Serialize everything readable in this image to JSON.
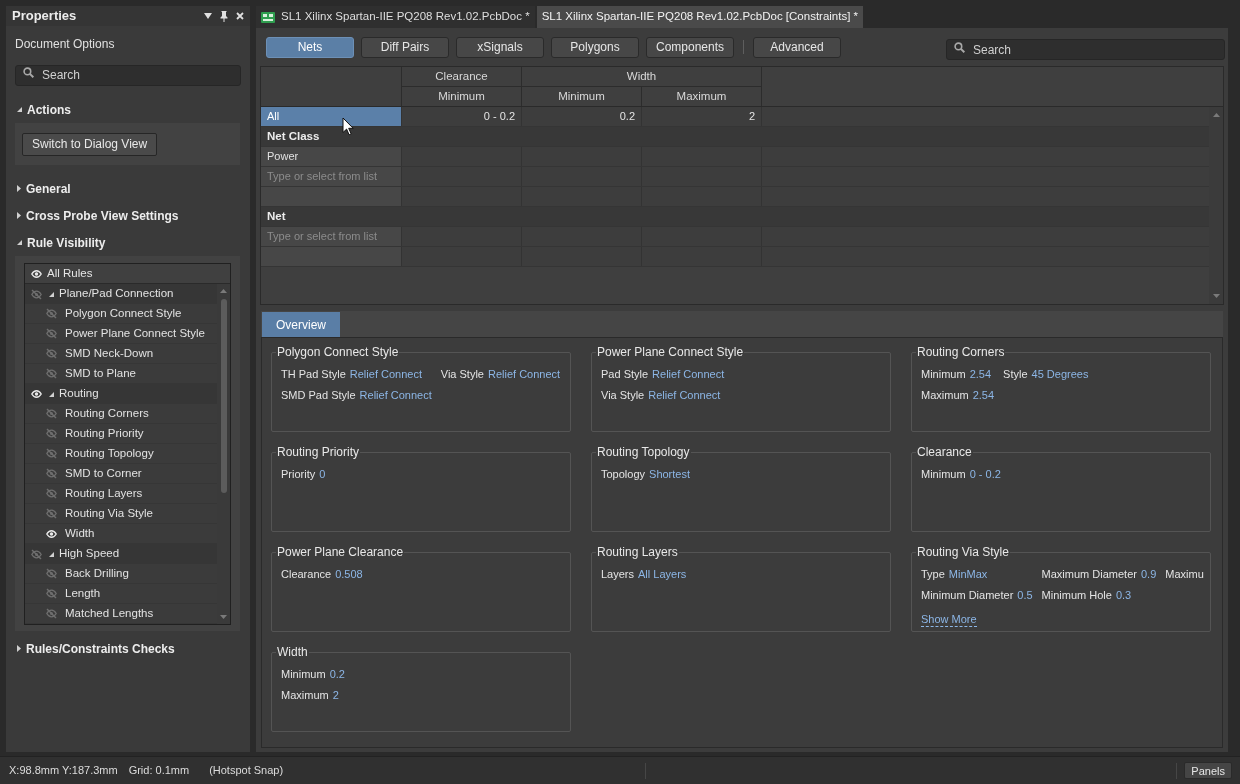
{
  "properties_panel": {
    "title": "Properties",
    "subtitle": "Document Options",
    "search": {
      "placeholder": "Search"
    },
    "sections": [
      {
        "kind": "actions",
        "title": "Actions",
        "expanded": true,
        "buttons": [
          "Switch to Dialog View"
        ]
      },
      {
        "kind": "plain",
        "title": "General",
        "expanded": false
      },
      {
        "kind": "plain",
        "title": "Cross Probe View Settings",
        "expanded": false
      },
      {
        "kind": "tree",
        "title": "Rule Visibility",
        "expanded": true,
        "tree": {
          "label": "All Rules",
          "visible": true,
          "children": [
            {
              "label": "Plane/Pad Connection",
              "visible": false,
              "expanded": true,
              "children": [
                {
                  "label": "Polygon Connect Style",
                  "visible": false
                },
                {
                  "label": "Power Plane Connect Style",
                  "visible": false
                },
                {
                  "label": "SMD Neck-Down",
                  "visible": false
                },
                {
                  "label": "SMD to Plane",
                  "visible": false
                }
              ]
            },
            {
              "label": "Routing",
              "visible": true,
              "expanded": true,
              "children": [
                {
                  "label": "Routing Corners",
                  "visible": false
                },
                {
                  "label": "Routing Priority",
                  "visible": false
                },
                {
                  "label": "Routing Topology",
                  "visible": false
                },
                {
                  "label": "SMD to Corner",
                  "visible": false
                },
                {
                  "label": "Routing Layers",
                  "visible": false
                },
                {
                  "label": "Routing Via Style",
                  "visible": false
                },
                {
                  "label": "Width",
                  "visible": true
                }
              ]
            },
            {
              "label": "High Speed",
              "visible": false,
              "expanded": true,
              "children": [
                {
                  "label": "Back Drilling",
                  "visible": false
                },
                {
                  "label": "Length",
                  "visible": false
                },
                {
                  "label": "Matched Lengths",
                  "visible": false
                }
              ]
            }
          ]
        }
      },
      {
        "kind": "plain",
        "title": "Rules/Constraints Checks",
        "expanded": false
      }
    ]
  },
  "document_tabs": [
    {
      "kind": "pcb",
      "label": "SL1 Xilinx Spartan-IIE PQ208 Rev1.02.PcbDoc *",
      "selected": false
    },
    {
      "kind": "constraints",
      "label": "SL1 Xilinx Spartan-IIE PQ208 Rev1.02.PcbDoc [Constraints] *",
      "selected": true
    }
  ],
  "object_buttons": [
    {
      "label": "Nets",
      "selected": true
    },
    {
      "label": "Diff Pairs",
      "selected": false
    },
    {
      "label": "xSignals",
      "selected": false
    },
    {
      "label": "Polygons",
      "selected": false
    },
    {
      "label": "Components",
      "selected": false
    }
  ],
  "advanced_button": {
    "label": "Advanced",
    "selected": false
  },
  "search": {
    "placeholder": "Search"
  },
  "constraints_table": {
    "column_groups": [
      {
        "label": "Clearance",
        "columns": [
          "Minimum"
        ]
      },
      {
        "label": "Width",
        "columns": [
          "Minimum",
          "Maximum"
        ]
      }
    ],
    "rows": [
      {
        "kind": "row",
        "label": "All",
        "selected": true,
        "cells": [
          "0 - 0.2",
          "0.2",
          "2"
        ]
      },
      {
        "kind": "section",
        "label": "Net Class"
      },
      {
        "kind": "row",
        "label": "Power",
        "selected": false
      },
      {
        "kind": "input",
        "placeholder": "Type or select from list"
      },
      {
        "kind": "blank"
      },
      {
        "kind": "section",
        "label": "Net"
      },
      {
        "kind": "input",
        "placeholder": "Type or select from list"
      },
      {
        "kind": "blank"
      }
    ]
  },
  "overview": {
    "tab": {
      "label": "Overview",
      "selected": true
    },
    "cards": [
      {
        "title": "Polygon Connect Style",
        "lines": [
          [
            {
              "label": "TH Pad Style",
              "value": "Relief Connect"
            },
            {
              "label": "Via Style",
              "value": "Relief Connect"
            }
          ],
          [
            {
              "label": "SMD Pad Style",
              "value": "Relief Connect"
            }
          ]
        ]
      },
      {
        "title": "Power Plane Connect Style",
        "lines": [
          [
            {
              "label": "Pad Style",
              "value": "Relief Connect"
            }
          ],
          [
            {
              "label": "Via Style",
              "value": "Relief Connect"
            }
          ]
        ]
      },
      {
        "title": "Routing Corners",
        "lines": [
          [
            {
              "label": "Minimum",
              "value": "2.54"
            },
            {
              "label": "Style",
              "value": "45 Degrees"
            }
          ],
          [
            {
              "label": "Maximum",
              "value": "2.54"
            }
          ]
        ]
      },
      {
        "title": "Routing Priority",
        "lines": [
          [
            {
              "label": "Priority",
              "value": "0"
            }
          ]
        ]
      },
      {
        "title": "Routing Topology",
        "lines": [
          [
            {
              "label": "Topology",
              "value": "Shortest"
            }
          ]
        ]
      },
      {
        "title": "Clearance",
        "lines": [
          [
            {
              "label": "Minimum",
              "value": "0 - 0.2"
            }
          ]
        ]
      },
      {
        "title": "Power Plane Clearance",
        "lines": [
          [
            {
              "label": "Clearance",
              "value": "0.508"
            }
          ]
        ]
      },
      {
        "title": "Routing Layers",
        "lines": [
          [
            {
              "label": "Layers",
              "value": "All Layers"
            }
          ]
        ]
      },
      {
        "title": "Routing Via Style",
        "lines": [
          [
            {
              "label": "Type",
              "value": "MinMax"
            },
            {
              "label": "Maximum Diameter",
              "value": "0.9"
            },
            {
              "label": "Maximu"
            }
          ],
          [
            {
              "label": "Minimum Diameter",
              "value": "0.5"
            },
            {
              "label": "Minimum Hole",
              "value": "0.3"
            }
          ]
        ],
        "link": "Show More"
      },
      {
        "title": "Width",
        "lines": [
          [
            {
              "label": "Minimum",
              "value": "0.2"
            }
          ],
          [
            {
              "label": "Maximum",
              "value": "2"
            }
          ]
        ]
      }
    ]
  },
  "status_bar": {
    "items": [
      "X:98.8mm Y:187.3mm",
      "Grid: 0.1mm",
      "(Hotspot Snap)"
    ],
    "panels_button": "Panels"
  }
}
